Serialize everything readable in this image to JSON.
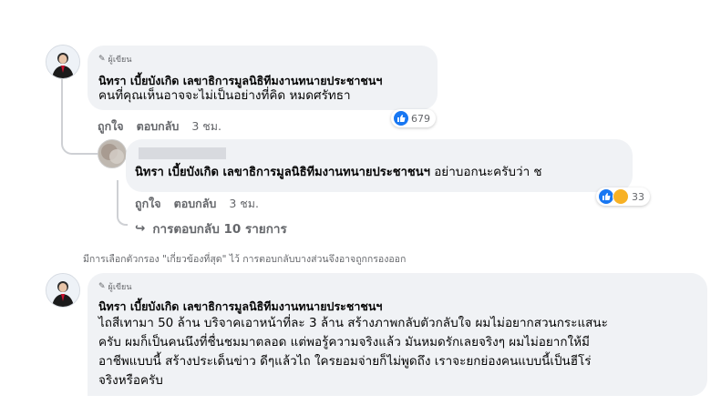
{
  "comments": [
    {
      "author_badge": "ผู้เขียน",
      "author": "นิทรา เบี้ยบังเกิด เลขาธิการมูลนิธิทีมงานทนายประชาชนฯ",
      "text": "คนที่คุณเห็นอาจจะไม่เป็นอย่างที่คิด หมดศรัทธา",
      "like_label": "ถูกใจ",
      "reply_label": "ตอบกลับ",
      "time": "3 ชม.",
      "reaction_count": "679"
    },
    {
      "author_redacted": true,
      "mention": "นิทรา เบี้ยบังเกิด เลขาธิการมูลนิธิทีมงานทนายประชาชนฯ",
      "text": "อย่าบอกนะครับว่า ช",
      "like_label": "ถูกใจ",
      "reply_label": "ตอบกลับ",
      "time": "3 ชม.",
      "reaction_count": "33"
    },
    {
      "author_badge": "ผู้เขียน",
      "author": "นิทรา เบี้ยบังเกิด เลขาธิการมูลนิธิทีมงานทนายประชาชนฯ",
      "lines": [
        "ไถสีเทามา 50 ล้าน บริจาคเอาหน้าที่ละ 3 ล้าน สร้างภาพกลับตัวกลับใจ ผมไม่อยากสวนกระแสนะ",
        "ครับ ผมก็เป็นคนนึงที่ชื่นชมมาตลอด แต่พอรู้ความจริงแล้ว มันหมดรักเลยจริงๆ ผมไม่อยากให้มี",
        "อาชีพแบบนี้ สร้างประเด็นข่าว ดีๆแล้วไถ ใครยอมจ่ายก็ไม่พูดถึง เราจะยกย่องคนแบบนี้เป็นฮีโร่",
        "จริงหรือครับ"
      ]
    }
  ],
  "view_replies": "การตอบกลับ 10 รายการ",
  "filter_notice": "มีการเลือกตัวกรอง \"เกี่ยวข้องที่สุด\" ไว้ การตอบกลับบางส่วนจึงอาจถูกกรองออก",
  "colors": {
    "like_blue": "#1877f2",
    "bubble": "#f0f2f5",
    "muted": "#65676b"
  }
}
